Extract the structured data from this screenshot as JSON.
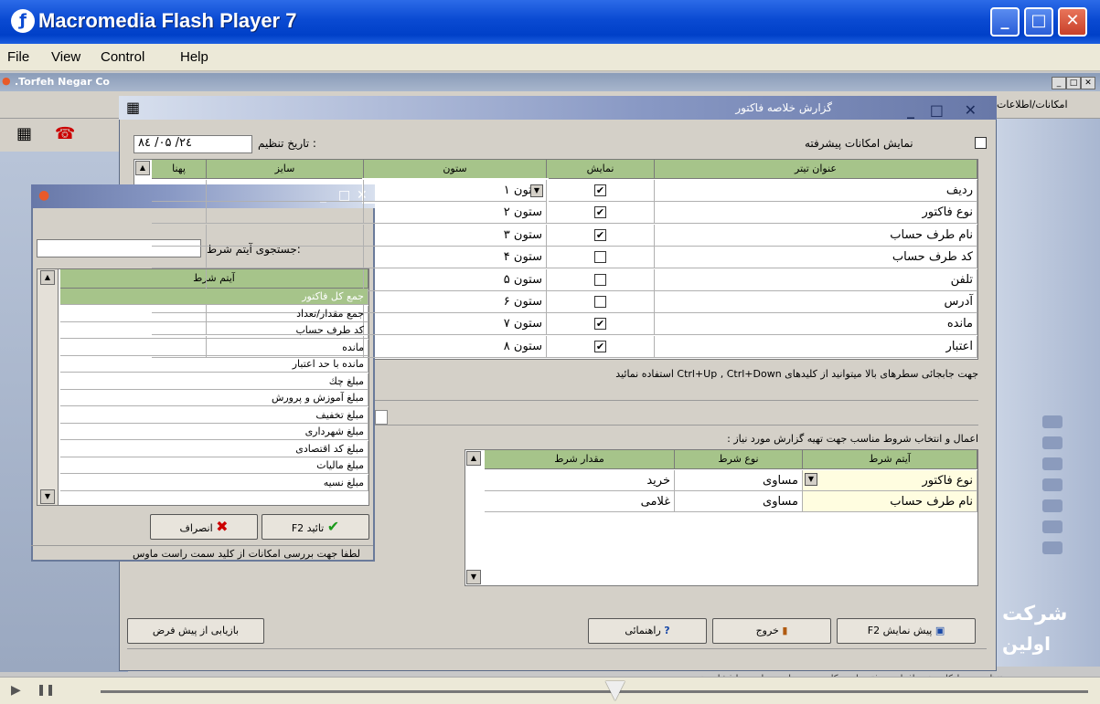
{
  "window": {
    "title": "Macromedia Flash Player 7"
  },
  "menu": [
    "File",
    "View",
    "Control",
    "Help"
  ],
  "mdi": {
    "title": ".Torfeh Negar Co",
    "right_menu": "امکانات/اطلاعات"
  },
  "report": {
    "title": "گزارش خلاصه فاکتور",
    "date_label": "تاریخ تنظیم :",
    "date_value": "۸٤ /۰۵ /۲٤",
    "advanced_label": "نمایش امکانات پیشرفته",
    "columns_headers": [
      "عنوان تیتر",
      "نمایش",
      "ستون",
      "سایز",
      "پهنا"
    ],
    "rows": [
      {
        "title": "ردیف",
        "show": true,
        "col": "ستون ۱"
      },
      {
        "title": "نوع فاکتور",
        "show": true,
        "col": "ستون ۲"
      },
      {
        "title": "نام طرف حساب",
        "show": true,
        "col": "ستون ۳"
      },
      {
        "title": "کد طرف حساب",
        "show": false,
        "col": "ستون ۴"
      },
      {
        "title": "تلفن",
        "show": false,
        "col": "ستون ۵"
      },
      {
        "title": "آدرس",
        "show": false,
        "col": "ستون ۶"
      },
      {
        "title": "مانده",
        "show": true,
        "col": "ستون ۷"
      },
      {
        "title": "اعتبار",
        "show": true,
        "col": "ستون ۸"
      }
    ],
    "hint": "جهت جابجائی سطرهای بالا میتوانید از کلیدهای  Ctrl+Up , Ctrl+Down  استفاده نمائید",
    "conditions_title": "اعمال و انتخاب شروط مناسب جهت تهیه گزارش  مورد نیاز :",
    "cond_headers": [
      "آیتم شرط",
      "نوع شرط",
      "مقدار شرط"
    ],
    "cond_rows": [
      {
        "item": "نوع فاکتور",
        "type": "مساوی",
        "value": "خرید"
      },
      {
        "item": "نام طرف حساب",
        "type": "مساوی",
        "value": "غلامی"
      }
    ],
    "buttons": {
      "preview": "F2 پیش نمایش",
      "exit": "خروج",
      "help": "راهنمائی",
      "reset": "بازیابی از پیش فرض"
    }
  },
  "popup": {
    "search_label": "جستجوی آیتم شرط:",
    "search_value": "",
    "list_header": "آیتم شرط",
    "items": [
      "جمع کل فاکتور",
      "جمع مقدار/تعداد",
      "کد طرف حساب",
      "مانده",
      "مانده با حد اعتبار",
      "مبلغ چك",
      "مبلغ آموزش و پرورش",
      "مبلغ تخفیف",
      "مبلغ شهرداری",
      "مبلغ کد اقتصادی",
      "مبلغ مالیات",
      "مبلغ نسیه"
    ],
    "ok": "F2 تائید",
    "cancel": "انصراف",
    "status": "لطفا جهت بررسی امکانات از کلید سمت راست ماوس"
  },
  "side": {
    "company1": "شرکت",
    "company2": "اولین"
  },
  "bottom_text": "جهت تنظیم محیط کاری نرم افزار به دفتر ما زیر کلید سمت راست ماوس را فشار دهید",
  "colors": {
    "header_green": "#a6c48a",
    "selected_row": "#a6c48a",
    "xp_blue": "#0a4ad2"
  }
}
